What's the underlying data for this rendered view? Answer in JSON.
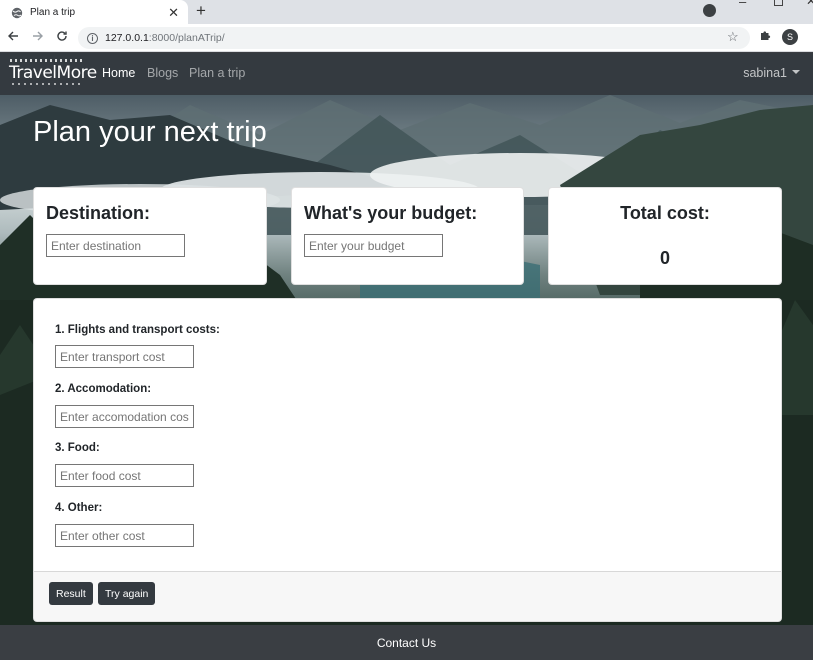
{
  "browser": {
    "tab_title": "Plan a trip",
    "new_tab_symbol": "+",
    "close_symbol": "✕",
    "url_host": "127.0.0.1",
    "url_path": ":8000/planATrip/",
    "profile_initial": "S",
    "icons": [
      "globe-icon",
      "back-arrow-icon",
      "forward-arrow-icon",
      "reload-icon",
      "info-icon",
      "star-icon",
      "extensions-icon",
      "download-icon"
    ]
  },
  "navbar": {
    "brand": "TravelMore",
    "links": [
      {
        "label": "Home",
        "active": true
      },
      {
        "label": "Blogs",
        "active": false
      },
      {
        "label": "Plan a trip",
        "active": false
      }
    ],
    "user": "sabina1"
  },
  "hero": {
    "title": "Plan your next trip"
  },
  "destination": {
    "heading": "Destination:",
    "placeholder": "Enter destination"
  },
  "budget": {
    "heading": "What's your budget:",
    "placeholder": "Enter your budget"
  },
  "total": {
    "heading": "Total cost:",
    "value": "0"
  },
  "costs": [
    {
      "label": "1. Flights and transport costs:",
      "placeholder": "Enter transport cost"
    },
    {
      "label": "2. Accomodation:",
      "placeholder": "Enter accomodation cost"
    },
    {
      "label": "3. Food:",
      "placeholder": "Enter food cost"
    },
    {
      "label": "4. Other:",
      "placeholder": "Enter other cost"
    }
  ],
  "buttons": {
    "result": "Result",
    "try_again": "Try again"
  },
  "footer": {
    "contact": "Contact Us"
  },
  "colors": {
    "navbar": "#343a40",
    "button": "#343a40",
    "footer": "#3a3e43"
  }
}
